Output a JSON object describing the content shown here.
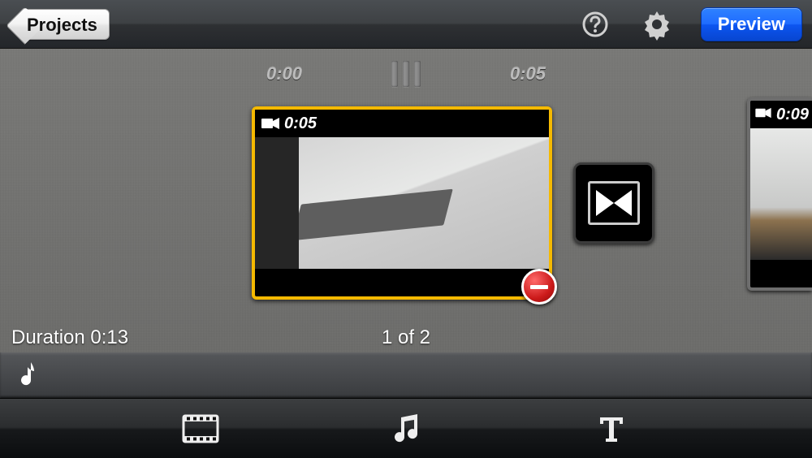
{
  "toolbar": {
    "back_label": "Projects",
    "preview_label": "Preview"
  },
  "icons": {
    "help": "help-icon",
    "settings": "gear-icon",
    "camera": "video-camera-icon",
    "transition": "crossfade-icon",
    "note": "music-note-icon",
    "film": "film-strip-icon",
    "music": "music-icon",
    "text": "text-icon"
  },
  "editor": {
    "time_start": "0:00",
    "time_end": "0:05",
    "clips": [
      {
        "time": "0:05",
        "selected": true
      },
      {
        "time": "0:09",
        "selected": false
      }
    ],
    "duration_label": "Duration 0:13",
    "clip_counter": "1 of 2"
  }
}
